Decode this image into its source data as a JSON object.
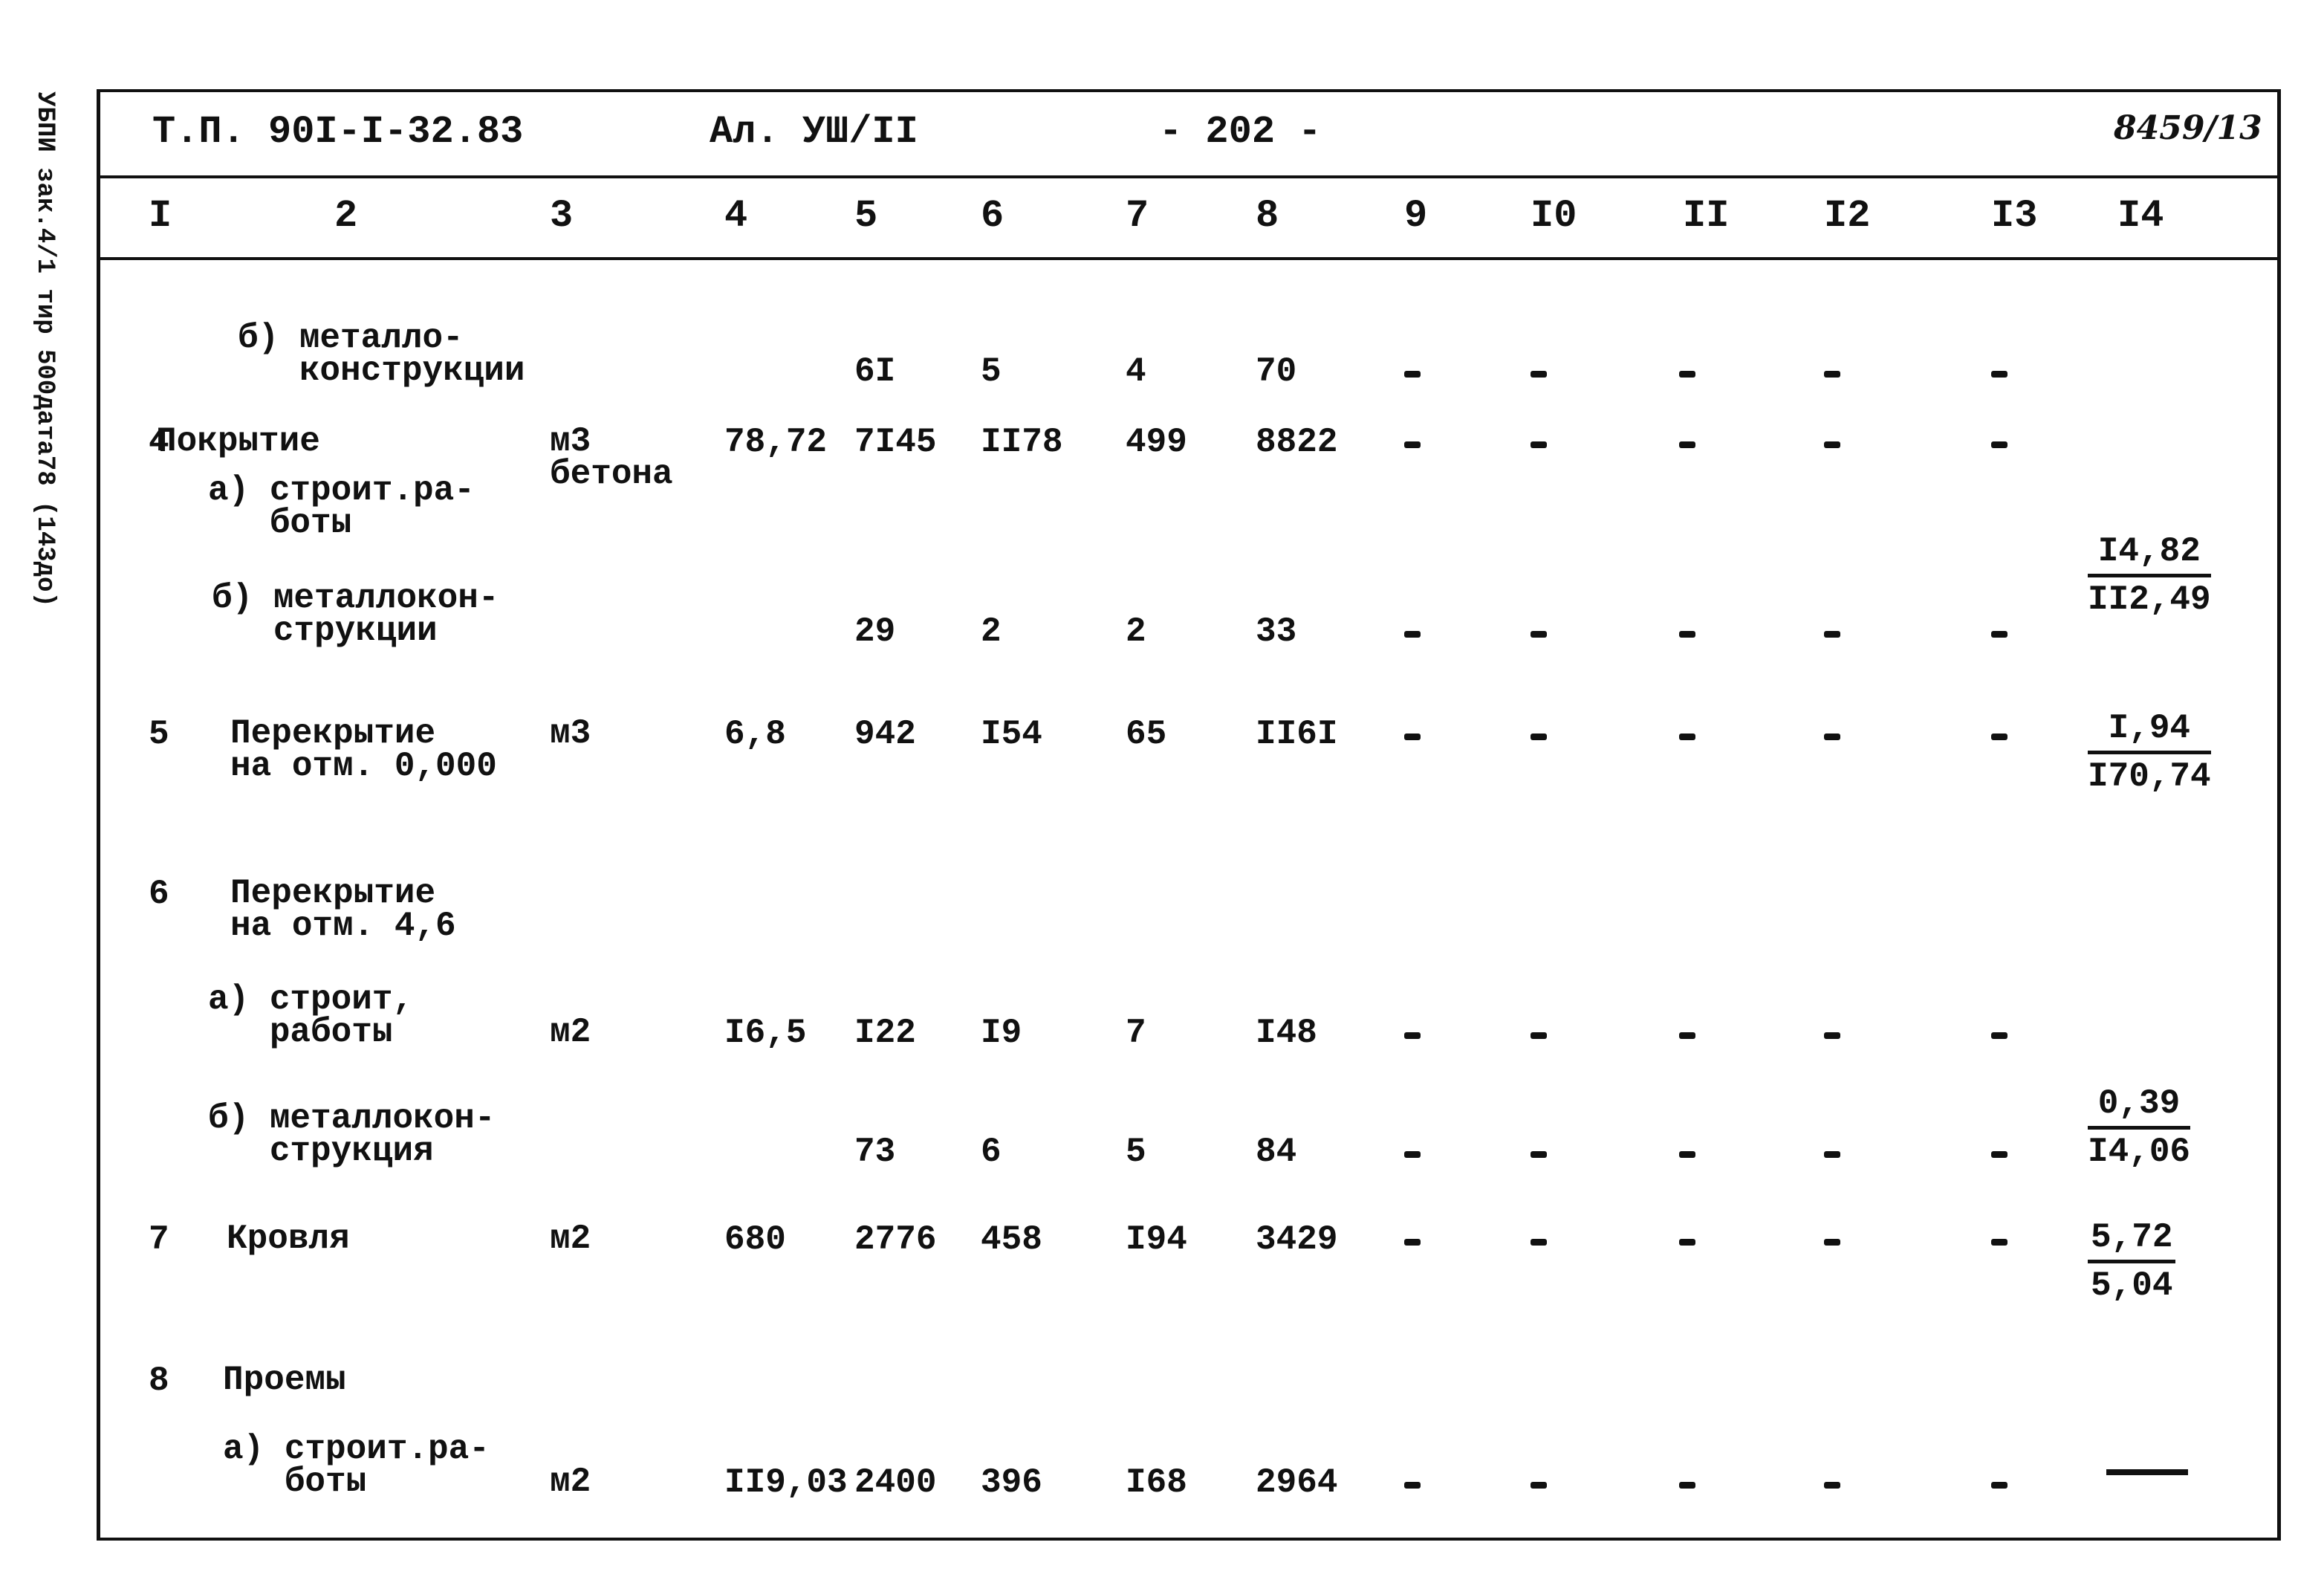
{
  "margin_note": "УБПИ зак.4/1 тир 500дата78 (143до)",
  "header": {
    "project": "Т.П. 90I-I-32.83",
    "album": "Ал. УШ/II",
    "page": "- 202 -",
    "sheet_code": "8459/13"
  },
  "columns": [
    "I",
    "2",
    "3",
    "4",
    "5",
    "6",
    "7",
    "8",
    "9",
    "I0",
    "II",
    "I2",
    "I3",
    "I4"
  ],
  "rows": [
    {
      "num": "",
      "desc": "б) металло-\n   конструкции",
      "unit": "",
      "c4": "",
      "c5": "6I",
      "c6": "5",
      "c7": "4",
      "c8": "70",
      "dashes": true,
      "c14_top": "",
      "c14_bottom": ""
    },
    {
      "num": "4",
      "desc": "Покрытие",
      "unit": "м3\nбетона",
      "c4": "78,72",
      "c5": "7I45",
      "c6": "II78",
      "c7": "499",
      "c8": "8822",
      "dashes": true,
      "c14_top": "",
      "c14_bottom": ""
    },
    {
      "num": "",
      "desc": "а) строит.ра-\n   боты",
      "unit": "",
      "c4": "",
      "c5": "",
      "c6": "",
      "c7": "",
      "c8": "",
      "dashes": false,
      "c14_top": "I4,82",
      "c14_bottom": "II2,49"
    },
    {
      "num": "",
      "desc": "б) металлокон-\n   струкции",
      "unit": "",
      "c4": "",
      "c5": "29",
      "c6": "2",
      "c7": "2",
      "c8": "33",
      "dashes": true,
      "c14_top": "",
      "c14_bottom": ""
    },
    {
      "num": "5",
      "desc": "Перекрытие\nна отм. 0,000",
      "unit": "м3",
      "c4": "6,8",
      "c5": "942",
      "c6": "I54",
      "c7": "65",
      "c8": "II6I",
      "dashes": true,
      "c14_top": "I,94",
      "c14_bottom": "I70,74"
    },
    {
      "num": "6",
      "desc": "Перекрытие\nна отм. 4,6",
      "unit": "",
      "c4": "",
      "c5": "",
      "c6": "",
      "c7": "",
      "c8": "",
      "dashes": false,
      "c14_top": "",
      "c14_bottom": ""
    },
    {
      "num": "",
      "desc": "а) строит,\n   работы",
      "unit": "м2",
      "c4": "I6,5",
      "c5": "I22",
      "c6": "I9",
      "c7": "7",
      "c8": "I48",
      "dashes": true,
      "c14_top": "",
      "c14_bottom": ""
    },
    {
      "num": "",
      "desc": "б) металлокон-\n   струкция",
      "unit": "",
      "c4": "",
      "c5": "73",
      "c6": "6",
      "c7": "5",
      "c8": "84",
      "dashes": true,
      "c14_top": "0,39",
      "c14_bottom": "I4,06"
    },
    {
      "num": "7",
      "desc": "Кровля",
      "unit": "м2",
      "c4": "680",
      "c5": "2776",
      "c6": "458",
      "c7": "I94",
      "c8": "3429",
      "dashes": true,
      "c14_top": "5,72",
      "c14_bottom": "5,04"
    },
    {
      "num": "8",
      "desc": "Проемы",
      "unit": "",
      "c4": "",
      "c5": "",
      "c6": "",
      "c7": "",
      "c8": "",
      "dashes": false,
      "c14_top": "",
      "c14_bottom": ""
    },
    {
      "num": "",
      "desc": "а) строит.ра-\n   боты",
      "unit": "м2",
      "c4": "II9,03",
      "c5": "2400",
      "c6": "396",
      "c7": "I68",
      "c8": "2964",
      "dashes": true,
      "c14_top": "",
      "c14_bottom": "",
      "c14_line": true
    }
  ]
}
